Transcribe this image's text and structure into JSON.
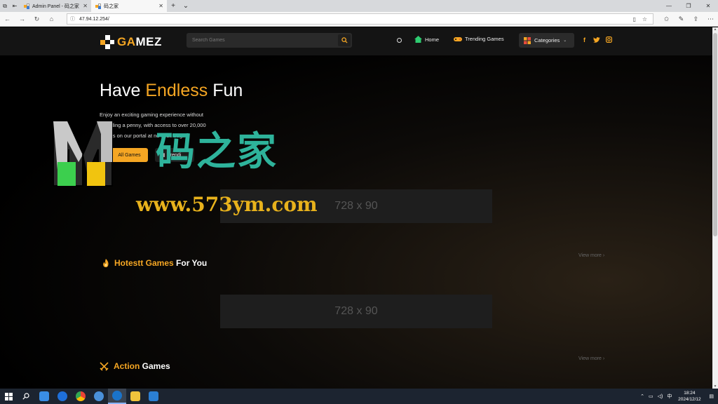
{
  "browser": {
    "tabs": [
      {
        "title": "Admin Panel - 码之家"
      },
      {
        "title": "码之家"
      }
    ],
    "new_tab_symbol": "+",
    "url": "47.94.12.254/"
  },
  "site": {
    "logo": {
      "prefix": "GA",
      "suffix": "MEZ"
    },
    "search_placeholder": "Search Games",
    "nav": {
      "home": "Home",
      "trending": "Trending Games",
      "categories": "Categories"
    },
    "social": [
      "f",
      "t",
      "ig"
    ],
    "hero": {
      "title_start": "Have ",
      "title_accent": "Endless",
      "title_end": " Fun",
      "desc_lines": [
        "Enjoy an exciting gaming experience without",
        "spending a penny, with access to over 20,000",
        "games on our portal at no cost. begin"
      ],
      "btn_all": "All Games",
      "btn_trending": "Trendi"
    },
    "ads": [
      "728 x 90",
      "728 x 90"
    ],
    "sections": [
      {
        "accent": "Hotestt Games",
        "rest": " For You",
        "icon": "fire-icon",
        "view_more": "View more"
      },
      {
        "accent": "Action",
        "rest": " Games",
        "icon": "swords-icon",
        "view_more": "View more"
      }
    ]
  },
  "watermark": {
    "brand": "码之家",
    "url": "www.573ym.com"
  },
  "taskbar": {
    "ime": "中",
    "time": "18:24",
    "date": "2024/12/12"
  },
  "colors": {
    "accent": "#f5a623",
    "header_bg": "#141414",
    "ad_bg": "#1e1e1e",
    "watermark_green": "#2eb39b",
    "watermark_gold": "#e8b21c"
  }
}
